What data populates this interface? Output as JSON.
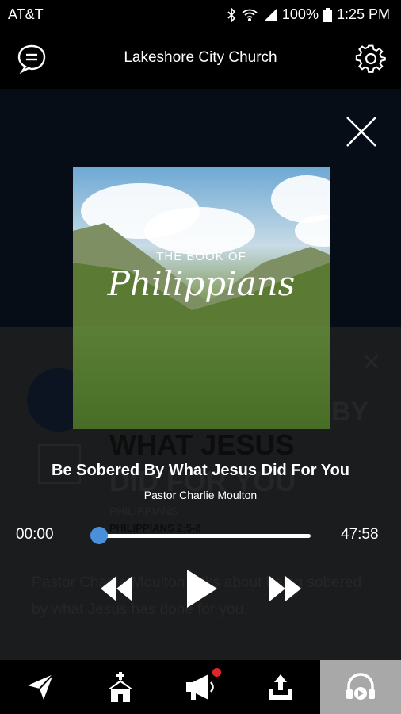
{
  "status": {
    "carrier": "AT&T",
    "battery": "100%",
    "time": "1:25 PM"
  },
  "header": {
    "title": "Lakeshore City Church"
  },
  "player": {
    "artwork": {
      "subtitle": "THE BOOK OF",
      "name": "Philippians"
    },
    "title": "Be Sobered By What Jesus Did For You",
    "speaker": "Pastor Charlie Moulton",
    "elapsed": "00:00",
    "duration": "47:58",
    "progress": 0
  },
  "background": {
    "heading_line1": "BY",
    "heading_line2": "WHAT JESUS",
    "heading_line3": "DID FOR YOU",
    "series": "PHILIPPIANS",
    "reference": "PHILIPPIANS 2:5-8",
    "description_line1": "Pastor Charlie Moulton talks about being sobered",
    "description_line2": "by what Jesus has done for you."
  },
  "nav": {
    "items": [
      "send-icon",
      "church-icon",
      "megaphone-icon",
      "tray-upload-icon",
      "headphones-icon"
    ],
    "active_index": 4
  },
  "colors": {
    "accent": "#4a90d9",
    "badge": "#e3242b",
    "nav_active": "#a8a8a8"
  }
}
